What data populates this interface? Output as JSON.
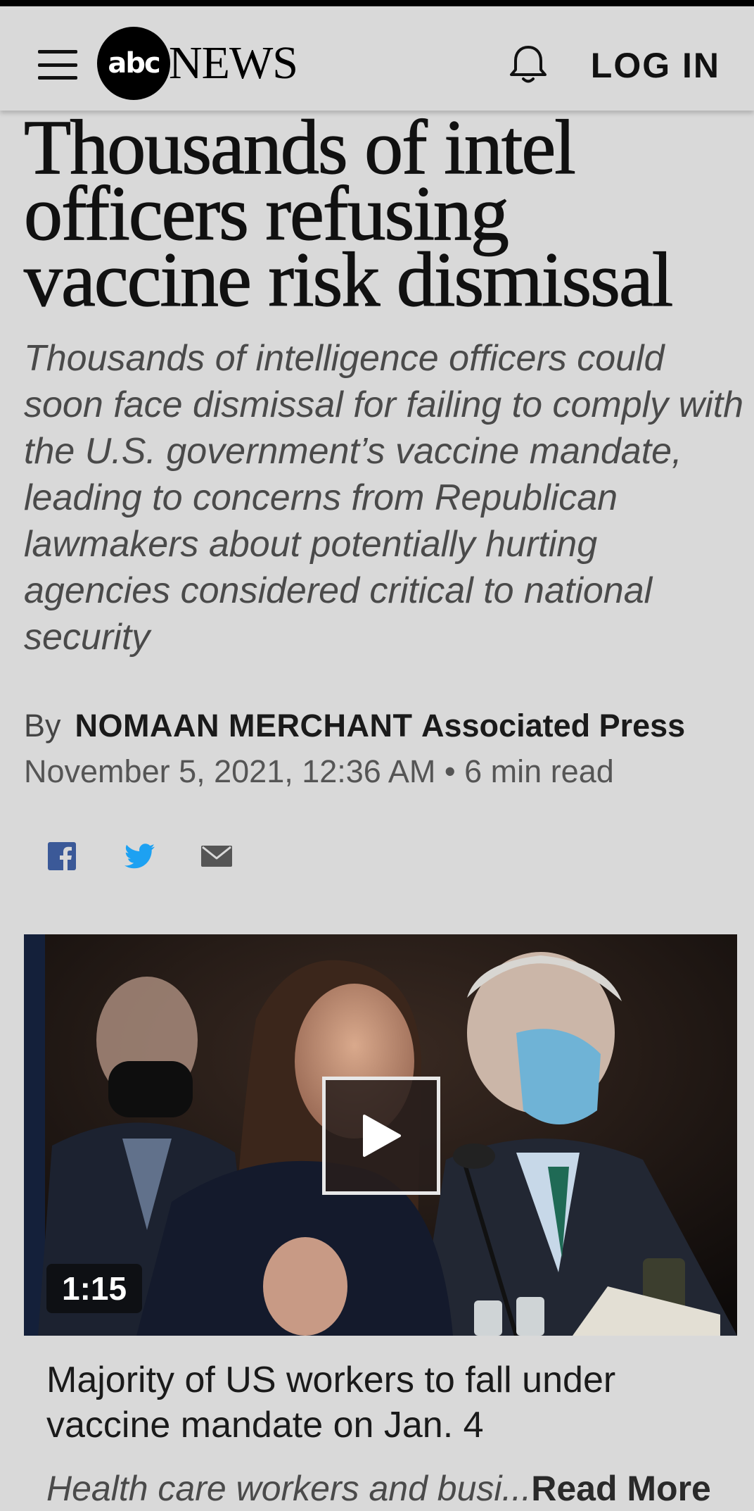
{
  "header": {
    "logo_abc": "abc",
    "logo_news": "NEWS",
    "login_label": "LOG IN"
  },
  "article": {
    "headline": "Thousands of intel officers refusing vaccine risk dismissal",
    "dek": "Thousands of intelligence officers could soon face dismissal for failing to comply with the U.S. government’s vaccine mandate, leading to concerns from Republican lawmakers about potentially hurting agencies considered critical to national security",
    "byline_prefix": "By",
    "author": "NOMAAN MERCHANT",
    "organization": "Associated Press",
    "date": "November 5, 2021, 12:36 AM",
    "separator": "•",
    "read_time": "6 min read"
  },
  "share": {
    "icons": [
      "facebook-icon",
      "twitter-icon",
      "email-icon"
    ],
    "colors": {
      "facebook": "#3b5998",
      "twitter": "#1da1f2",
      "email": "#555555"
    }
  },
  "video": {
    "duration": "1:15",
    "title": "Majority of US workers to fall under vaccine mandate on Jan. 4",
    "description": "Health care workers and busi...",
    "read_more": "Read More"
  },
  "colors": {
    "background": "#d9d9d9",
    "text": "#1a1a1a"
  }
}
